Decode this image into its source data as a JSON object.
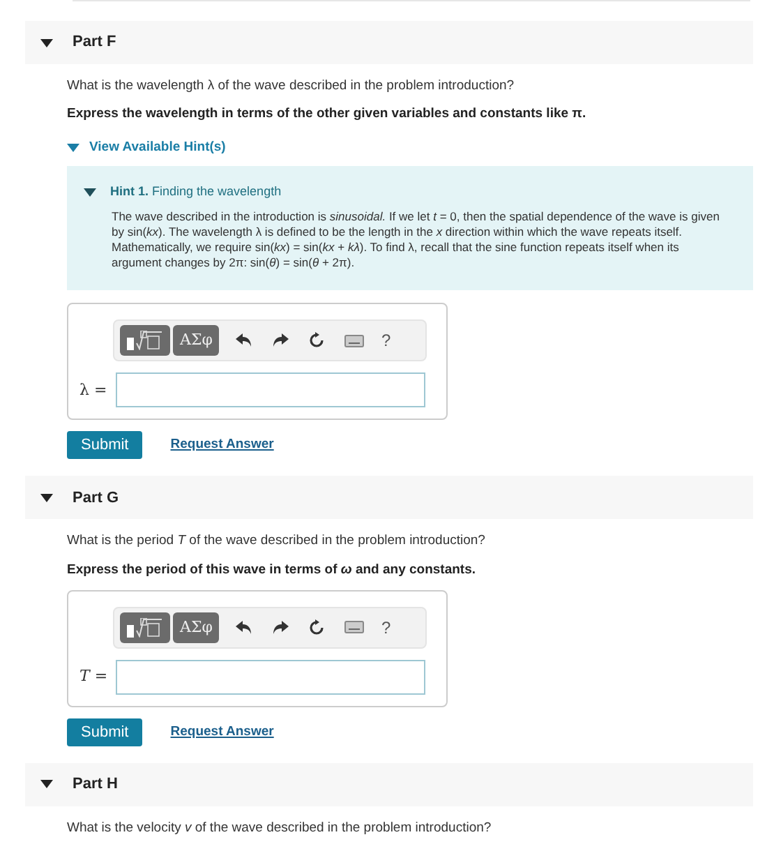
{
  "parts": [
    {
      "label": "Part F",
      "expanded": true,
      "question": "What is the wavelength λ of the wave described in the problem introduction?",
      "instruction": "Express the wavelength in terms of the other given variables and constants like π.",
      "hints_toggle": {
        "label": "View Available Hint(s)",
        "expanded": true
      },
      "hints": [
        {
          "title": "**Hint 1.** Finding the wavelength",
          "expanded": true,
          "body": "The wave described in the introduction is *sinusoidal.* If we let *t* = 0, then the spatial dependence of the wave is given by sin(*kx*). The wavelength λ is defined to be the length in the *x* direction within which the wave repeats itself. Mathematically, we require sin(*kx*) = sin(*kx* + *kλ*). To find λ, recall that the sine function repeats itself when its argument changes by 2π: sin(*θ*) = sin(*θ* + 2π)."
        }
      ],
      "answer": {
        "variable": "λ =",
        "greek_button": "ΑΣφ",
        "help_button": "?",
        "submit": "Submit",
        "request": "Request Answer"
      }
    },
    {
      "label": "Part G",
      "expanded": true,
      "question": "What is the period *T* of the wave described in the problem introduction?",
      "instruction": "Express the period of this wave in terms of *ω* and any constants.",
      "answer": {
        "variable": "*T* =",
        "greek_button": "ΑΣφ",
        "help_button": "?",
        "submit": "Submit",
        "request": "Request Answer"
      }
    },
    {
      "label": "Part H",
      "expanded": true,
      "question": "What is the velocity *v* of the wave described in the problem introduction?"
    }
  ]
}
